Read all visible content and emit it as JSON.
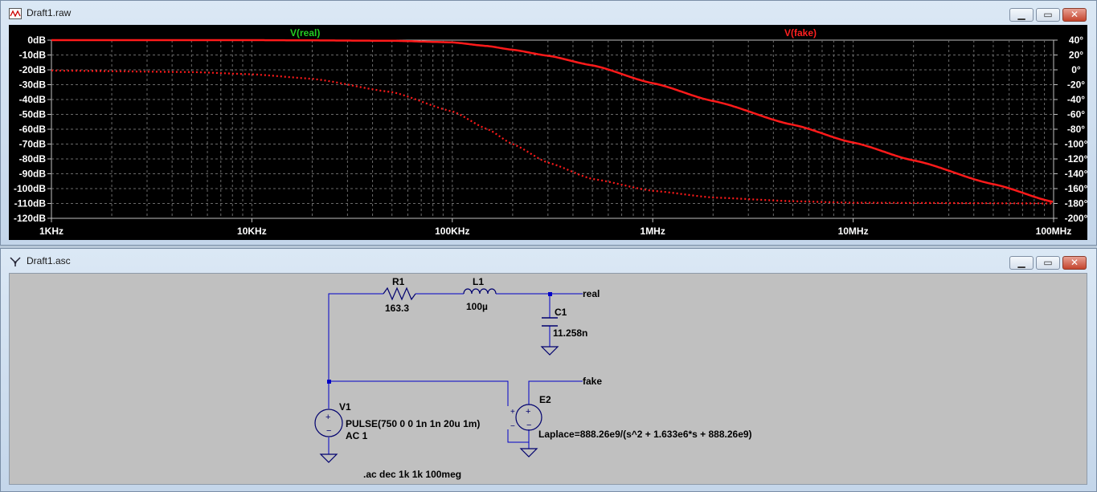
{
  "plot_window": {
    "title": "Draft1.raw",
    "icon": "waveform-icon",
    "controls": {
      "minimize": "▁",
      "maximize": "▭",
      "close": "✕"
    }
  },
  "schematic_window": {
    "title": "Draft1.asc",
    "icon": "schematic-icon",
    "controls": {
      "minimize": "▁",
      "maximize": "▭",
      "close": "✕"
    }
  },
  "chart_data": {
    "type": "line",
    "x_scale": "log",
    "x_range_hz": [
      1000,
      100000000
    ],
    "x_tick_labels": [
      "1KHz",
      "10KHz",
      "100KHz",
      "1MHz",
      "10MHz",
      "100MHz"
    ],
    "y_left_range_db": [
      -120,
      0
    ],
    "y_left_tick_labels": [
      "0dB",
      "-10dB",
      "-20dB",
      "-30dB",
      "-40dB",
      "-50dB",
      "-60dB",
      "-70dB",
      "-80dB",
      "-90dB",
      "-100dB",
      "-110dB",
      "-120dB"
    ],
    "y_right_range_deg": [
      -200,
      40
    ],
    "y_right_tick_labels": [
      "40°",
      "20°",
      "0°",
      "-20°",
      "-40°",
      "-60°",
      "-80°",
      "-100°",
      "-120°",
      "-140°",
      "-160°",
      "-180°",
      "-200°"
    ],
    "grid": true,
    "trace_labels": [
      {
        "name": "V(real)",
        "color": "#22cc22"
      },
      {
        "name": "V(fake)",
        "color": "#ff2020"
      }
    ],
    "series": [
      {
        "trace": "magnitude",
        "style": "solid",
        "color": "#ff1a1a",
        "freq_hz": [
          1000,
          10000,
          50000,
          100000,
          150000,
          200000,
          300000,
          500000,
          1000000,
          2000000,
          5000000,
          10000000,
          20000000,
          50000000,
          100000000
        ],
        "values": [
          0,
          0,
          -0.4,
          -1.5,
          -4,
          -6.5,
          -10.5,
          -17,
          -29,
          -41,
          -57,
          -69,
          -81,
          -97,
          -109
        ]
      },
      {
        "trace": "phase",
        "style": "dotted",
        "color": "#ff1a1a",
        "freq_hz": [
          1000,
          5000,
          10000,
          20000,
          50000,
          100000,
          150000,
          200000,
          300000,
          500000,
          1000000,
          2000000,
          5000000,
          10000000,
          100000000
        ],
        "values": [
          -1,
          -3,
          -6,
          -12,
          -30,
          -56,
          -80,
          -100,
          -125,
          -147,
          -163,
          -172,
          -177,
          -179,
          -180
        ]
      }
    ]
  },
  "schematic": {
    "r1_name": "R1",
    "r1_value": "163.3",
    "l1_name": "L1",
    "l1_value": "100µ",
    "c1_name": "C1",
    "c1_value": "11.258n",
    "real_label": "real",
    "fake_label": "fake",
    "e2_name": "E2",
    "e2_value": "Laplace=888.26e9/(s^2 + 1.633e6*s + 888.26e9)",
    "v1_name": "V1",
    "v1_value": "PULSE(750 0 0 1n 1n 20u 1m)",
    "v1_ac": "AC 1",
    "directive": ".ac dec 1k 1k 100meg",
    "wire_color": "#0000c8",
    "symbol_color": "#00006e"
  }
}
